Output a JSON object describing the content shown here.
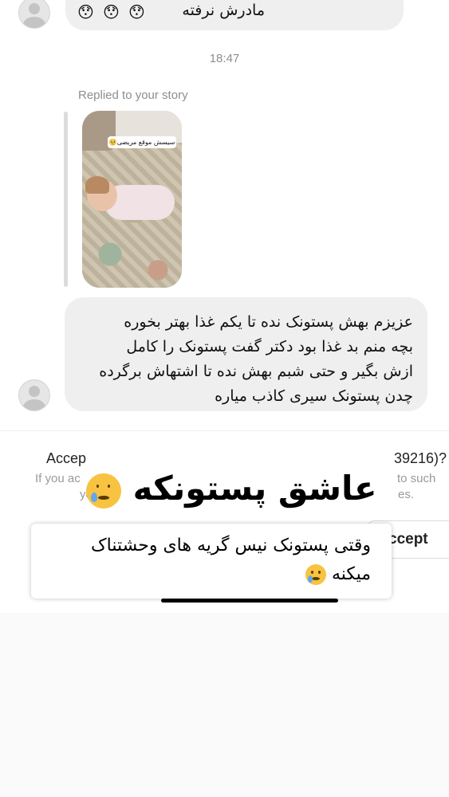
{
  "chat": {
    "top_message": "مادرش نرفته",
    "top_message_emoji": [
      "😯",
      "😯",
      "😯"
    ],
    "timestamp": "18:47",
    "replied_label": "Replied to your story",
    "story_sticker": "سیسش موقع مریضی🥺",
    "main_message_lines": [
      "عزیزم بهش پستونک نده تا یکم غذا بهتر بخوره",
      "بچه منم بد غذا بود دکتر گفت پستونک را کامل",
      "ازش بگیر و حتی شبم بهش نده تا اشتهاش برگرده",
      "چدن پستونک سیری کاذب میاره"
    ]
  },
  "sheet": {
    "accept_title": "Accep",
    "accept_number": "39216)?",
    "sub_left_1": "If you ac",
    "sub_left_2": "yo",
    "sub_right_1": "to such",
    "sub_right_2": "es.",
    "accept_button": "ccept"
  },
  "overlay": {
    "title": "عاشق پستونکه",
    "caption": "وقتی پستونک نیس گریه های وحشتناک میکنه",
    "emoji_name": "crying-face"
  },
  "colors": {
    "bubble": "#efefef",
    "muted_text": "#8e8e8e",
    "emoji_yellow": "#f7c341"
  }
}
